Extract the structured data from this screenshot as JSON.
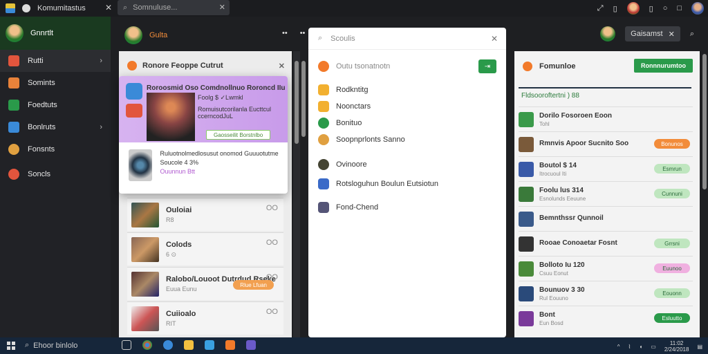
{
  "titlebar": {
    "tab_title": "Komumitastus",
    "address": "Somnuluse..."
  },
  "sidebar": {
    "user_name": "Gnnrtlt",
    "items": [
      {
        "label": "Rutti",
        "icon": "chat-icon",
        "color": "#e2553d"
      },
      {
        "label": "Somints",
        "icon": "briefcase-icon",
        "color": "#e8823a"
      },
      {
        "label": "Foedtuts",
        "icon": "puzzle-icon",
        "color": "#2a9a4a"
      },
      {
        "label": "Bonlruts",
        "icon": "grid-icon",
        "color": "#3a8ad8"
      },
      {
        "label": "Fonsnts",
        "icon": "clock-icon",
        "color": "#e0a040"
      },
      {
        "label": "Soncls",
        "icon": "fire-icon",
        "color": "#e2553d"
      }
    ]
  },
  "appbar": {
    "title": "Gulta",
    "user_label": "Gaisamst"
  },
  "left_column": {
    "heading": "Ronore Feoppe Cutrut",
    "rows": [
      {
        "title": "Ouloiai",
        "meta": "R8",
        "badge": "OO"
      },
      {
        "title": "Colods",
        "meta": "6 ⊙",
        "badge": "OO"
      },
      {
        "title": "Ralobo/Louoot Dutrdud Rseke",
        "meta": "Euua Eunu",
        "badge": "OO",
        "pill": "Rlue Lfuan"
      },
      {
        "title": "Cuiioalo",
        "meta": "RIT",
        "badge": "OO"
      }
    ]
  },
  "popup": {
    "title": "Roroosmid Oso Comdnollnuo Roroncd IIu",
    "subtitle": "Foolg $ ✓Lwmkl",
    "body": "Romuisutcorilanla Eucttcul ccerncodJuL",
    "button": "Gaosseilit Borstnlbo",
    "bottom_text": "Ruluotnolmedlosusut onomod Guuuotutme Soucole 4 3%",
    "bottom_link": "Ouunnun Btt"
  },
  "dialog": {
    "search_placeholder": "Scoulis",
    "header_row": "Outu tsonatnotn",
    "items": [
      "Rodkntitg",
      "Noonctars",
      "Bonituo",
      "Soopnprlonts  Sanno",
      "Ovinoore",
      "Rotsloguhun  Boulun Eutsiotun",
      "Fond-Chend"
    ]
  },
  "right_panel": {
    "heading": "Fomunloe",
    "button": "Ronnnurumtoo",
    "filter": "Fldsooroftertni ) 88",
    "rows": [
      {
        "name": "Dorilo Fosoroen Eoon",
        "meta": "Tohl",
        "tag": "",
        "tag_color": "",
        "av": "#3a9a4a"
      },
      {
        "name": "Rmnvis Apoor Sucnito Soo",
        "meta": "",
        "tag": "Bonunos",
        "tag_color": "#f28c3a",
        "av": "#7a5a3a"
      },
      {
        "name": "Boutol $ 14",
        "meta": "Itrocuoul Iti",
        "tag": "Esmrun",
        "tag_color": "#bfe6bf",
        "av": "#3a5aa8"
      },
      {
        "name": "Foolu lus 314",
        "meta": "Esnolunds Eeuune",
        "tag": "Cunnuni",
        "tag_color": "#bfe6bf",
        "av": "#3a7a3a"
      },
      {
        "name": "Bemnthssr Qunnoil",
        "meta": "",
        "tag": "",
        "tag_color": "",
        "av": "#3a5a8a"
      },
      {
        "name": "Rooae Conoaetar Fosnt",
        "meta": "",
        "tag": "Grrsni",
        "tag_color": "#bfe6bf",
        "av": "#333"
      },
      {
        "name": "Bolloto Iu 120",
        "meta": "Csuu Eonut",
        "tag": "Euunoo",
        "tag_color": "#f0b0e0",
        "av": "#4a8a3a"
      },
      {
        "name": "Bounuov 3 30",
        "meta": "Rul Eouuno",
        "tag": "Eouonn",
        "tag_color": "#bfe6bf",
        "av": "#2a4a7a"
      },
      {
        "name": "Bont",
        "meta": "Eun Bosd",
        "tag": "Esluutto",
        "tag_color": "#2a9a4a",
        "av": "#7a3a9a"
      }
    ]
  },
  "taskbar": {
    "search_text": "Ehoor binlolo",
    "tray_time": "11:02",
    "tray_date": "2/24/2018"
  }
}
